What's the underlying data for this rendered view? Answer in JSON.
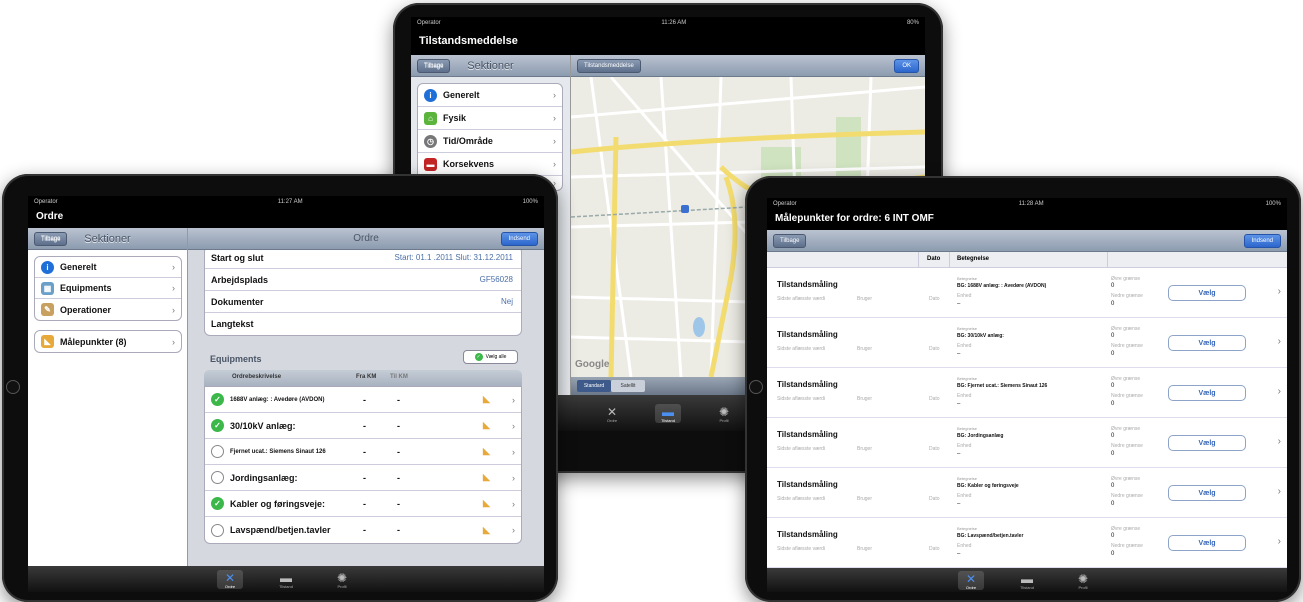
{
  "center": {
    "carrier": "Operator",
    "time": "11:26 AM",
    "battery": "80%",
    "title": "Tilstandsmeddelse",
    "left_back": "Tilbage",
    "left_header": "Sektioner",
    "map_back": "Tilstandsmeddelse",
    "ok": "OK",
    "items": [
      {
        "label": "Generelt",
        "icon": "info-icon",
        "color": "#1f6fd8"
      },
      {
        "label": "Fysik",
        "icon": "fysik-icon",
        "color": "#5bb43c"
      },
      {
        "label": "Tid/Område",
        "icon": "clock-icon",
        "color": "#777777"
      },
      {
        "label": "Korsekvens",
        "icon": "korsekvens-icon",
        "color": "#c42424"
      }
    ],
    "seg": [
      "Standard",
      "Satellit"
    ],
    "google": "Google",
    "tabs": [
      "Ordre",
      "Tilstand",
      "Profil"
    ]
  },
  "left": {
    "carrier": "Operator",
    "time": "11:27 AM",
    "battery": "100%",
    "title": "Ordre",
    "left_back": "Tilbage",
    "left_header": "Sektioner",
    "right_header": "Ordre",
    "right_btn": "Indsend",
    "items": [
      {
        "label": "Generelt",
        "icon": "info-icon",
        "color": "#1f6fd8"
      },
      {
        "label": "Equipments",
        "icon": "equipments-icon",
        "color": "#6aa0c8"
      },
      {
        "label": "Operationer",
        "icon": "operationer-icon",
        "color": "#c8a060"
      }
    ],
    "malepunkter": "Målepunkter (8)",
    "details": [
      {
        "label": "Start og slut",
        "value": "Start: 01.1 .2011  Slut: 31.12.2011"
      },
      {
        "label": "Arbejdsplads",
        "value": "GF56028"
      },
      {
        "label": "Dokumenter",
        "value": "Nej"
      },
      {
        "label": "Langtekst",
        "value": ""
      }
    ],
    "equipments_title": "Equipments",
    "vaelg_alle": "Vælg alle",
    "eq_headers": [
      "Ordrebeskrivelse",
      "Fra KM",
      "Til KM"
    ],
    "eq_rows": [
      {
        "label": "1688V anlæg: : Avedøre (AVDON)",
        "checked": true,
        "fra": "-",
        "til": "-"
      },
      {
        "label": "30/10kV anlæg:",
        "checked": true,
        "fra": "-",
        "til": "-"
      },
      {
        "label": "Fjernet ucat.: Siemens Sinaut 126",
        "checked": false,
        "fra": "-",
        "til": "-"
      },
      {
        "label": "Jordingsanlæg:",
        "checked": false,
        "fra": "-",
        "til": "-"
      },
      {
        "label": "Kabler og føringsveje:",
        "checked": true,
        "fra": "-",
        "til": "-"
      },
      {
        "label": "Lavspænd/betjen.tavler",
        "checked": false,
        "fra": "-",
        "til": "-"
      }
    ],
    "tabs": [
      "Ordre",
      "Tilstand",
      "Profil"
    ]
  },
  "right": {
    "carrier": "Operator",
    "time": "11:28 AM",
    "battery": "100%",
    "title": "Målepunkter for ordre: 6 INT OMF",
    "back": "Tilbage",
    "btn": "Indsend",
    "col_dato": "Dato",
    "col_betegnelse": "Betegnelse",
    "row_title": "Tilstandsmåling",
    "sidste": "Sidste aflæsste værdi",
    "bruger": "Bruger",
    "dato": "Dato",
    "betegnelse_lbl": "Betegnelse",
    "enhed_lbl": "Enhed",
    "ovre_lbl": "Øvre grænse",
    "nedre_lbl": "Nedre grænse",
    "zero": "0",
    "dash": "–",
    "vaelg": "Vælg",
    "rows": [
      {
        "bet": "BG: 1688V anlæg: : Avedøre (AVDON)"
      },
      {
        "bet": "BG: 30/10kV anlæg:"
      },
      {
        "bet": "BG: Fjernet ucat.: Siemens Sinaut 126"
      },
      {
        "bet": "BG: Jordingsanlæg"
      },
      {
        "bet": "BG: Kabler og føringsveje"
      },
      {
        "bet": "BG: Lavspænd/betjen.tavler"
      }
    ],
    "tabs": [
      "Ordre",
      "Tilstand",
      "Profil"
    ]
  }
}
